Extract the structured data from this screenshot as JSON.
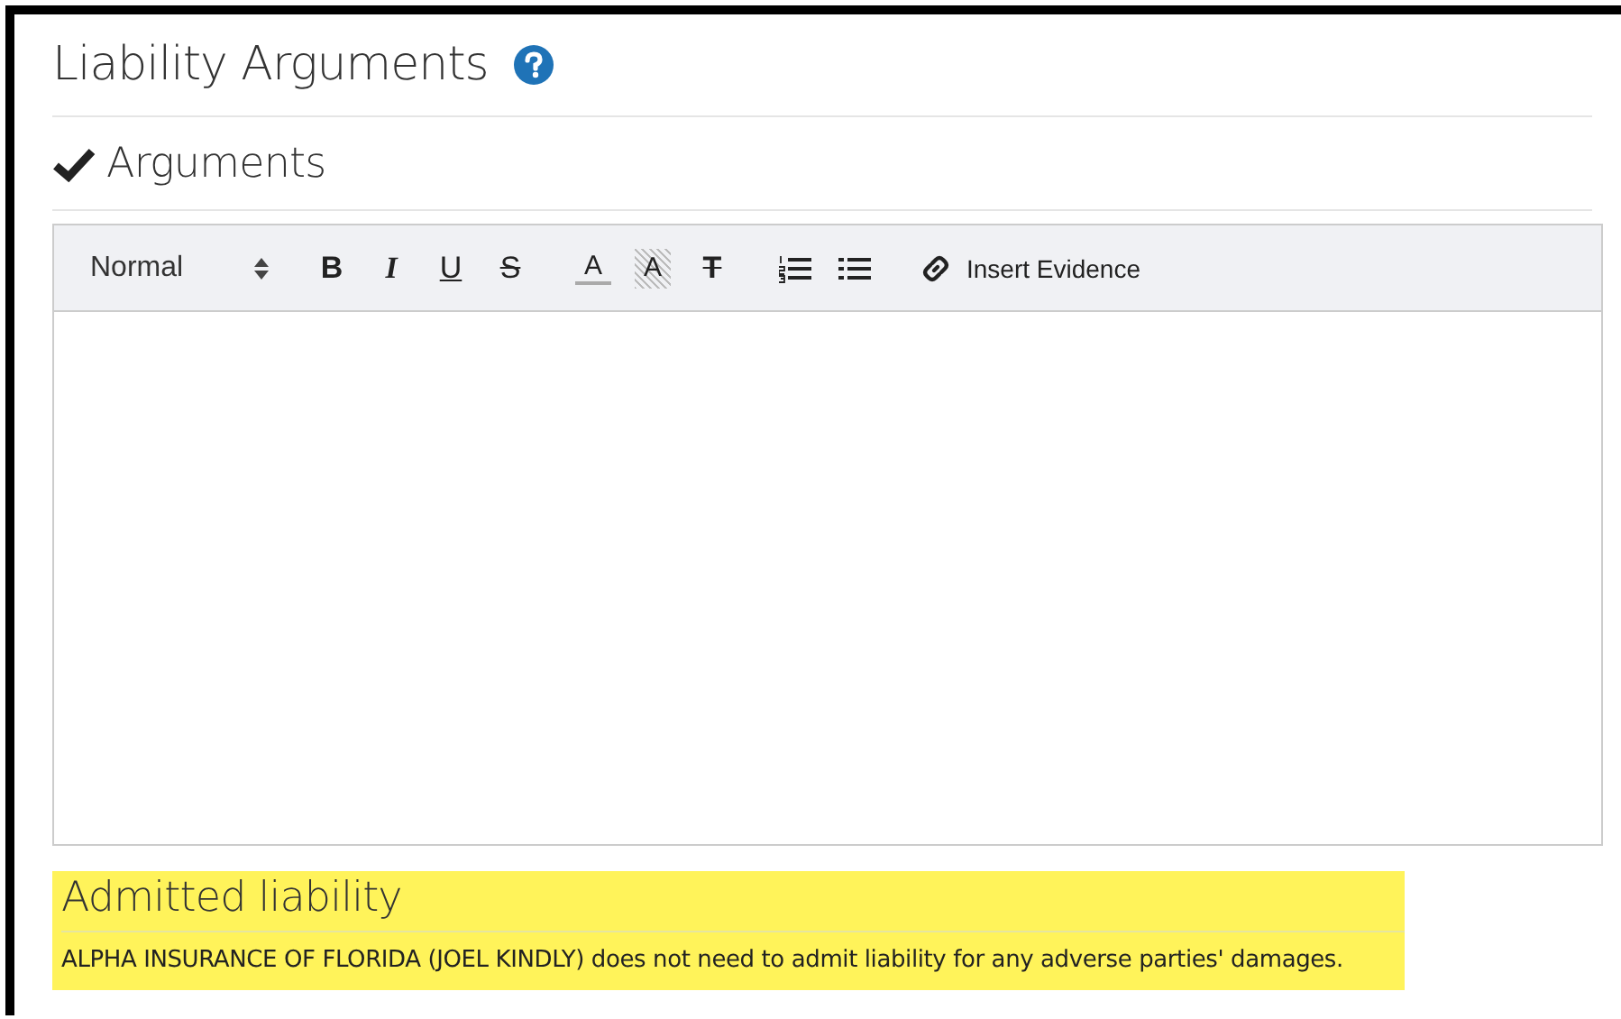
{
  "page": {
    "title": "Liability Arguments",
    "help": true
  },
  "section": {
    "title": "Arguments",
    "complete": true
  },
  "editor": {
    "format": "Normal",
    "buttons": [
      {
        "kind": "bold",
        "label": "B"
      },
      {
        "kind": "italic",
        "label": "I"
      },
      {
        "kind": "underline",
        "label": "U"
      },
      {
        "kind": "strike",
        "label": "S"
      },
      {
        "kind": "color",
        "label": "A"
      },
      {
        "kind": "background",
        "label": "A"
      },
      {
        "kind": "clean",
        "label": "T"
      },
      {
        "kind": "ordered-list"
      },
      {
        "kind": "bullet-list"
      }
    ],
    "link": "Insert Evidence"
  },
  "notice": {
    "title": "Admitted liability",
    "text": "ALPHA INSURANCE OF FLORIDA (JOEL KINDLY) does not need to admit liability for any adverse parties' damages.",
    "highlighted": true
  }
}
